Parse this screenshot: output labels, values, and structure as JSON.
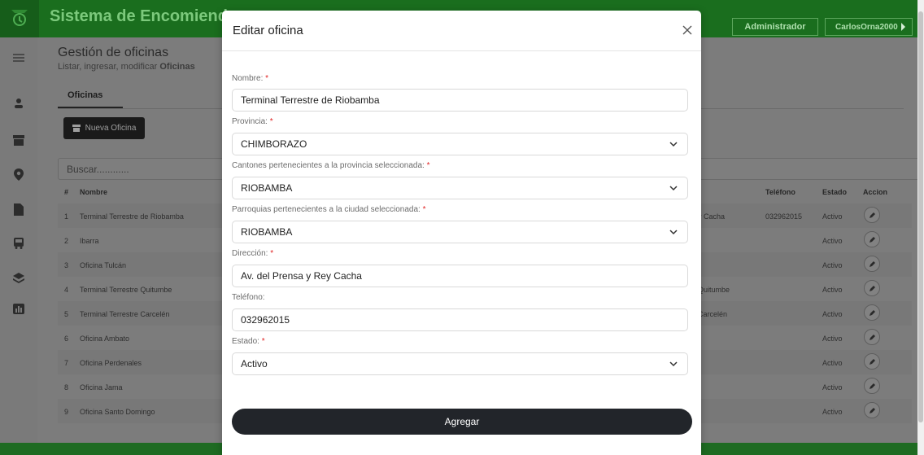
{
  "app": {
    "title": "Sistema de Encomiendas",
    "role": "Administrador",
    "user": "CarlosOrna2000"
  },
  "page": {
    "title": "Gestión de oficinas",
    "subtitle_prefix": "Listar, ingresar, modificar ",
    "subtitle_bold": "Oficinas"
  },
  "tab": {
    "label": "Oficinas"
  },
  "new_button": {
    "label": "Nueva Oficina"
  },
  "search": {
    "placeholder": "Buscar............"
  },
  "table": {
    "headers": {
      "num": "#",
      "name": "Nombre",
      "phone": "Teléfono",
      "state": "Estado",
      "action": "Accion"
    },
    "rows": [
      {
        "num": "1",
        "name": "Terminal Terrestre de Riobamba",
        "extra": "y Cacha",
        "phone": "032962015",
        "state": "Activo"
      },
      {
        "num": "2",
        "name": "Ibarra",
        "extra": "",
        "phone": "",
        "state": "Activo"
      },
      {
        "num": "3",
        "name": "Oficina Tulcán",
        "extra": "",
        "phone": "",
        "state": "Activo"
      },
      {
        "num": "4",
        "name": "Terminal Terrestre Quitumbe",
        "extra": "Quitumbe",
        "phone": "",
        "state": "Activo"
      },
      {
        "num": "5",
        "name": "Terminal Terrestre Carcelén",
        "extra": "Carcelén",
        "phone": "",
        "state": "Activo"
      },
      {
        "num": "6",
        "name": "Oficina Ambato",
        "extra": "",
        "phone": "",
        "state": "Activo"
      },
      {
        "num": "7",
        "name": "Oficina Perdenales",
        "extra": "",
        "phone": "",
        "state": "Activo"
      },
      {
        "num": "8",
        "name": "Oficina Jama",
        "extra": "",
        "phone": "",
        "state": "Activo"
      },
      {
        "num": "9",
        "name": "Oficina Santo Domingo",
        "extra": "",
        "phone": "",
        "state": "Activo"
      }
    ]
  },
  "modal": {
    "title": "Editar oficina",
    "fields": {
      "nombre": {
        "label": "Nombre:",
        "value": "Terminal Terrestre de Riobamba"
      },
      "provincia": {
        "label": "Provincia:",
        "value": "CHIMBORAZO"
      },
      "canton": {
        "label": "Cantones pertenecientes a la provincia seleccionada:",
        "value": "RIOBAMBA"
      },
      "parroquia": {
        "label": "Parroquias pertenecientes a la ciudad seleccionada:",
        "value": "RIOBAMBA"
      },
      "direccion": {
        "label": "Dirección:",
        "value": "Av. del Prensa y Rey Cacha"
      },
      "telefono": {
        "label": "Teléfono:",
        "value": "032962015"
      },
      "estado": {
        "label": "Estado:",
        "value": "Activo"
      }
    },
    "required_mark": "*",
    "submit_label": "Agregar"
  },
  "colors": {
    "brand_green": "#1a6e1e",
    "modal_button": "#22252a",
    "required": "#e02424"
  }
}
